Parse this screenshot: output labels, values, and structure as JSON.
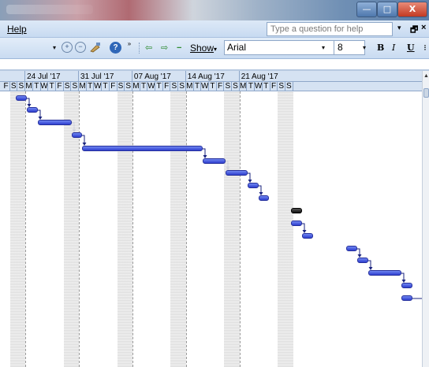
{
  "window": {
    "min_glyph": "—",
    "max_glyph": "□",
    "close_glyph": "X"
  },
  "menubar": {
    "help_label": "Help",
    "question_placeholder": "Type a question for help",
    "question_arrow": "▾",
    "restore_glyph": "🗗",
    "close_glyph": "×"
  },
  "toolbar": {
    "dropdown_glyph": "▾",
    "zoom_in_glyph": "+",
    "zoom_out_glyph": "−",
    "help_glyph": "?",
    "more_glyph": "»",
    "outdent_glyph": "⇦",
    "indent_glyph": "⇨",
    "hide_subtasks_glyph": "−",
    "show_label": "Show",
    "show_arrow": "▾",
    "font": "Arial",
    "font_arrow": "▾",
    "font_size": "8",
    "size_arrow": "▾",
    "bold_label": "B",
    "italic_label": "I",
    "underline_label": "U",
    "edge_glyph": "⠇"
  },
  "timescale": {
    "weeks": [
      "24 Jul '17",
      "31 Jul '17",
      "07 Aug '17",
      "14 Aug '17",
      "21 Aug '17"
    ],
    "leading_days": [
      "F",
      "S",
      "S"
    ],
    "week_days": [
      "M",
      "T",
      "W",
      "T",
      "F",
      "S",
      "S"
    ]
  },
  "colors": {
    "task_bar": "#3344dd",
    "summary_bar": "#222222",
    "header_bg": "#d5e2f2"
  },
  "scrollbar": {
    "up_glyph": "▲",
    "thumb_glyph": "≡"
  }
}
